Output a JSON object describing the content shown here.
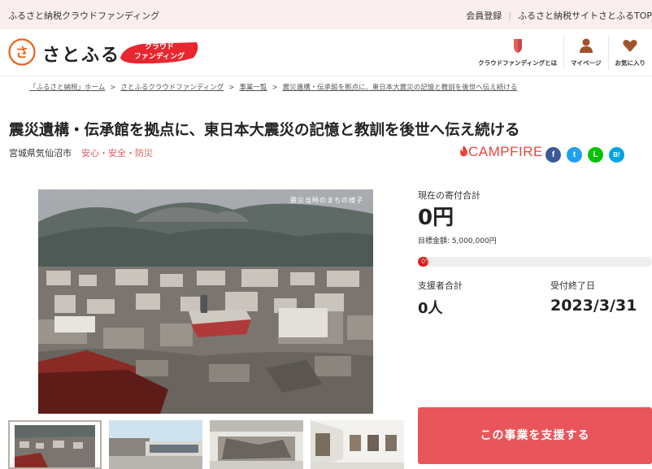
{
  "topbar": {
    "site_name": "ふるさと納税クラウドファンディング",
    "register": "会員登録",
    "site_top": "ふるさと納税サイトさとふるTOP"
  },
  "header": {
    "logo_mark_text": "さ",
    "logo_text": "さとふる",
    "badge_line1": "クラウド",
    "badge_line2": "ファンディング",
    "nav": [
      {
        "label": "クラウドファンディングとは",
        "icon": "shield-icon"
      },
      {
        "label": "マイページ",
        "icon": "user-icon"
      },
      {
        "label": "お気に入り",
        "icon": "heart-icon"
      }
    ]
  },
  "breadcrumb": [
    "「ふるさと納税」ホーム",
    "さとふるクラウドファンディング",
    "事業一覧",
    "震災遺構・伝承館を拠点に、東日本大震災の記憶と教訓を後世へ伝え続ける"
  ],
  "project": {
    "title": "震災遺構・伝承館を拠点に、東日本大震災の記憶と教訓を後世へ伝え続ける",
    "location": "宮城県気仙沼市",
    "category": "安心・安全・防災",
    "platform": "CAMPFIRE",
    "hero_caption": "震災当時のまちの様子"
  },
  "share": [
    {
      "name": "facebook-icon",
      "glyph": "f",
      "color": "#3b5998"
    },
    {
      "name": "twitter-icon",
      "glyph": "t",
      "color": "#1da1f2"
    },
    {
      "name": "line-icon",
      "glyph": "L",
      "color": "#00c300"
    },
    {
      "name": "hatena-icon",
      "glyph": "B!",
      "color": "#00a4de"
    }
  ],
  "stats": {
    "donation_label": "現在の寄付合計",
    "donation_value": "0円",
    "goal_label": "目標金額: 5,000,000円",
    "progress_text": "0%",
    "progress_fraction": 0,
    "supporters_label": "支援者合計",
    "supporters_value": "0人",
    "deadline_label": "受付終了日",
    "deadline_value": "2023/3/31"
  },
  "support_button": "この事業を支援する",
  "colors": {
    "accent": "#e8565b",
    "badge": "#e8262f",
    "topbar_bg": "#fbeeee",
    "progress": "#d81b1b"
  }
}
